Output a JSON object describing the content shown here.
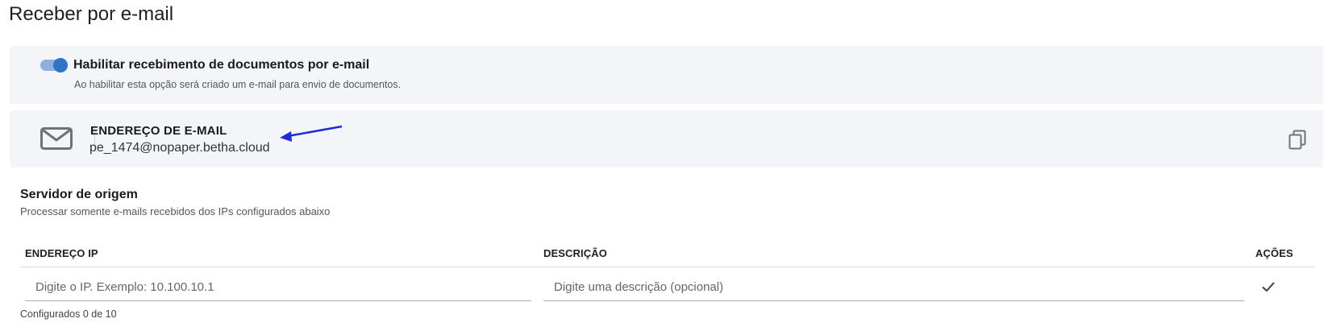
{
  "page": {
    "title": "Receber por e-mail"
  },
  "toggle": {
    "enabled": true,
    "label": "Habilitar recebimento de documentos por e-mail",
    "description": "Ao habilitar esta opção será criado um e-mail para envio de documentos."
  },
  "email_card": {
    "label": "ENDEREÇO DE E-MAIL",
    "address": "pe_1474@nopaper.betha.cloud",
    "icon": "mail-icon",
    "copy_icon": "copy-icon",
    "arrow_color": "#1f2bd6"
  },
  "origin_server": {
    "title": "Servidor de origem",
    "description": "Processar somente e-mails recebidos dos IPs configurados abaixo",
    "columns": [
      "ENDEREÇO IP",
      "DESCRIÇÃO",
      "AÇÕES"
    ],
    "ip_placeholder": "Digite o IP. Exemplo: 10.100.10.1",
    "desc_placeholder": "Digite uma descrição (opcional)",
    "confirm_icon": "check-icon",
    "count_text": "Configurados 0 de 10"
  },
  "colors": {
    "panel_bg": "#f4f5f9",
    "toggle_on": "#2f74c6",
    "toggle_track": "#8fb0de"
  }
}
